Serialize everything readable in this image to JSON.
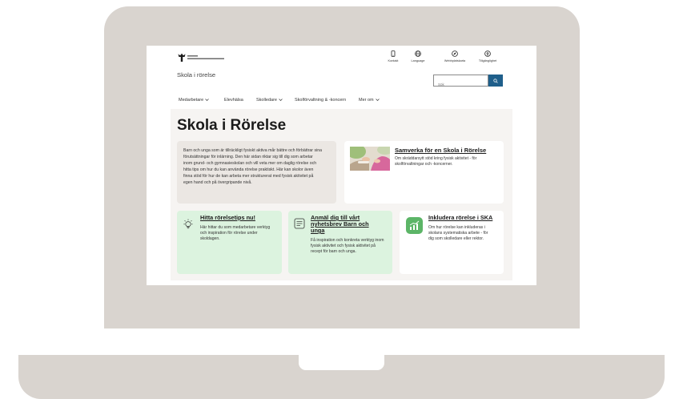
{
  "colors": {
    "laptop_body": "#d9d4cf",
    "accent_blue": "#1f5f8b",
    "page_background": "#f6f4f2",
    "intro_card": "#ebe7e3",
    "card_green": "#dcf3df",
    "icon_green": "#5cb567"
  },
  "header": {
    "logo_icon": "crown-logo-icon",
    "site_title": "Skola i rörelse",
    "utility_links": [
      {
        "label": "Kontakt",
        "icon": "phone-icon"
      },
      {
        "label": "Language",
        "icon": "globe-icon"
      },
      {
        "label": "Webbplatskarta",
        "icon": "compass-icon"
      },
      {
        "label": "Tillgänglighet",
        "icon": "accessibility-icon"
      }
    ],
    "search": {
      "placeholder": "Sök",
      "value": "",
      "button_icon": "search-icon"
    }
  },
  "main_nav": [
    {
      "label": "Medarbetare",
      "has_dropdown": true
    },
    {
      "label": "Elevhälsa",
      "has_dropdown": false
    },
    {
      "label": "Skolledare",
      "has_dropdown": true
    },
    {
      "label": "Skolförvaltning & -koncern",
      "has_dropdown": false
    },
    {
      "label": "Mer om",
      "has_dropdown": true
    }
  ],
  "page": {
    "heading": "Skola i Rörelse",
    "intro": "Barn och unga som är tillräckligt fysiskt aktiva mår bättre och förbättrar sina förutsättningar för inlärning. Den här sidan riktar sig till dig som arbetar inom grund- och gymnasieskolan och vill veta mer om daglig rörelse och hitta tips om hur du kan använda rörelse praktiskt. Här kan skolor även finna stöd för hur de kan arbeta mer strukturerat med fysisk aktivitet på egen hand och på övergripande nivå."
  },
  "featured_card": {
    "image_icon": "collaboration-photo",
    "title": "Samverka för en Skola i Rörelse",
    "description": "Om skräddarsytt stöd kring fysisk aktivitet - för skolförvaltningar och -koncerner."
  },
  "cards": [
    {
      "icon": "lightbulb-icon",
      "title": "Hitta rörelsetips nu!",
      "text": "Här hittar du som medarbetare verktyg och inspiration för rörelse under skoldagen."
    },
    {
      "icon": "newsletter-icon",
      "title": "Anmäl dig till vårt nyhetsbrev Barn och unga",
      "text": "Få inspiration och konkreta verktyg inom fysisk aktivitet och fysisk aktivitet på recept för barn och unga."
    },
    {
      "icon": "chart-growth-icon",
      "title": "Inkludera rörelse i SKA",
      "text": "Om hur rörelse kan inkluderas i skolans systematiska arbete - för dig som skolledare eller rektor."
    }
  ]
}
